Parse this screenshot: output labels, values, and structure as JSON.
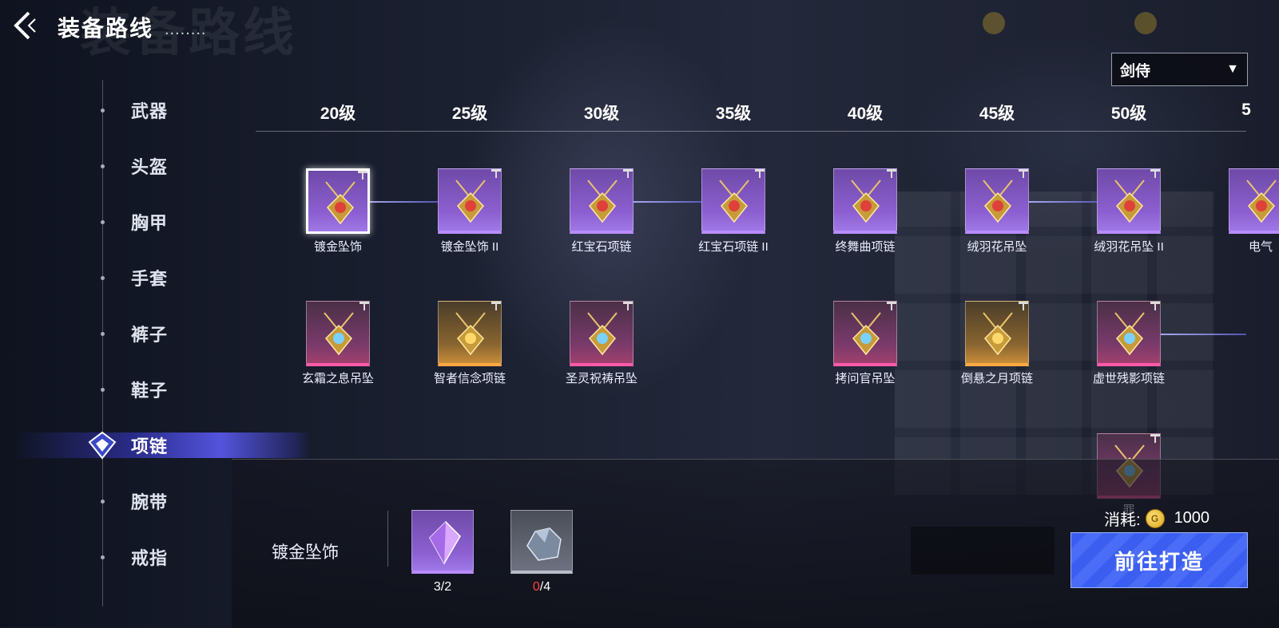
{
  "header": {
    "title": "装备路线",
    "dots": "........",
    "ghost_title": "装备路线"
  },
  "class_select": {
    "value": "剑侍"
  },
  "nav": {
    "items": [
      {
        "label": "武器"
      },
      {
        "label": "头盔"
      },
      {
        "label": "胸甲"
      },
      {
        "label": "手套"
      },
      {
        "label": "裤子"
      },
      {
        "label": "鞋子"
      },
      {
        "label": "项链",
        "active": true
      },
      {
        "label": "腕带"
      },
      {
        "label": "戒指"
      }
    ]
  },
  "levels": [
    "20级",
    "25级",
    "30级",
    "35级",
    "40级",
    "45级",
    "50级",
    "5"
  ],
  "row1": [
    {
      "name": "镀金坠饰",
      "rarity": "purple",
      "selected": true
    },
    {
      "name": "镀金坠饰 II",
      "rarity": "purple"
    },
    {
      "name": "红宝石项链",
      "rarity": "purple"
    },
    {
      "name": "红宝石项链 II",
      "rarity": "purple"
    },
    {
      "name": "终舞曲项链",
      "rarity": "purple"
    },
    {
      "name": "绒羽花吊坠",
      "rarity": "purple"
    },
    {
      "name": "绒羽花吊坠 II",
      "rarity": "purple"
    },
    {
      "name": "电气",
      "rarity": "purple"
    }
  ],
  "row2": [
    {
      "name": "玄霜之息吊坠",
      "rarity": "pink"
    },
    {
      "name": "智者信念项链",
      "rarity": "gold"
    },
    {
      "name": "圣灵祝祷吊坠",
      "rarity": "pink"
    },
    {
      "name": "拷问官吊坠",
      "rarity": "pink"
    },
    {
      "name": "倒悬之月项链",
      "rarity": "gold"
    },
    {
      "name": "虚世残影项链",
      "rarity": "pink"
    }
  ],
  "row3": [
    {
      "name": "罪",
      "rarity": "pink"
    }
  ],
  "bottom": {
    "selected_name": "镀金坠饰",
    "materials": [
      {
        "name": "purple-crystal",
        "have": "3",
        "need": "/2",
        "insufficient": false
      },
      {
        "name": "iron-ore",
        "have": "0",
        "need": "/4",
        "insufficient": true
      }
    ],
    "cost_label": "消耗:",
    "cost_value": "1000",
    "forge_button": "前往打造"
  },
  "colors": {
    "accent": "#4a6cf6",
    "purple": "#8c5fd0",
    "pink": "#ff5aa8",
    "gold": "#ffa840"
  }
}
